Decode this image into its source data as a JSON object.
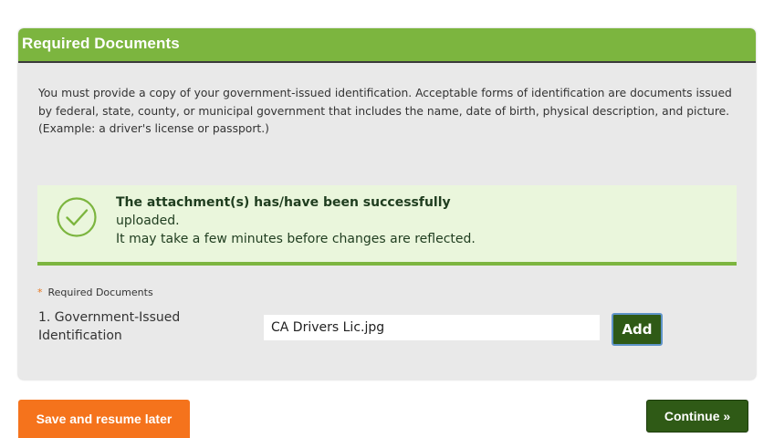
{
  "colors": {
    "header_green": "#7cb53f",
    "notice_bg": "#eaf6dc",
    "dark_green_button": "#2f5a16",
    "orange_button": "#f5731c",
    "required_asterisk": "#e8771e",
    "panel_bg": "#e9e9e9"
  },
  "panel": {
    "title": "Required Documents",
    "intro_text": "You must provide a copy of your government-issued identification.  Acceptable forms of identification are documents issued by federal, state, county, or municipal government that includes the name, date of birth, physical description, and picture. (Example: a driver's license or passport.)"
  },
  "notice": {
    "icon": "check-circle-icon",
    "title": "The attachment(s) has/have been successfully",
    "line1": "uploaded.",
    "line2": "It may take a few minutes before changes are reflected."
  },
  "required_documents": {
    "asterisk": "*",
    "label": "Required Documents",
    "items": [
      {
        "label": "1. Government-Issued Identification",
        "file_value": "CA Drivers Lic.jpg",
        "add_label": "Add"
      }
    ]
  },
  "footer": {
    "save_label": "Save and resume later",
    "continue_label": "Continue »"
  }
}
